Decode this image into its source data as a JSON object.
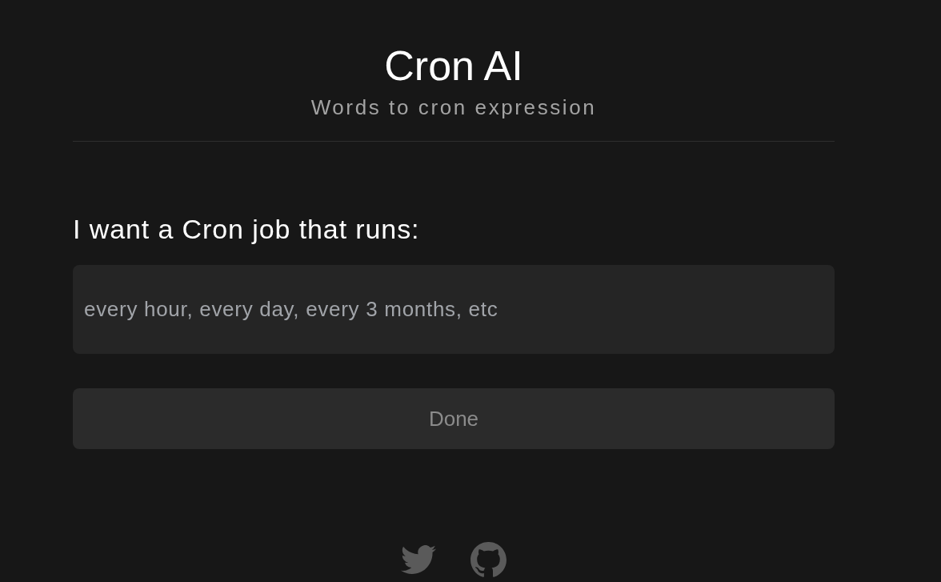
{
  "header": {
    "title": "Cron AI",
    "subtitle": "Words to cron expression"
  },
  "form": {
    "label": "I want a Cron job that runs:",
    "input": {
      "placeholder": "every hour, every day, every 3 months, etc"
    },
    "button": {
      "label": "Done",
      "disabled": true
    }
  },
  "footer": {
    "links": [
      {
        "kind": "bird"
      },
      {
        "kind": "cat"
      }
    ]
  }
}
